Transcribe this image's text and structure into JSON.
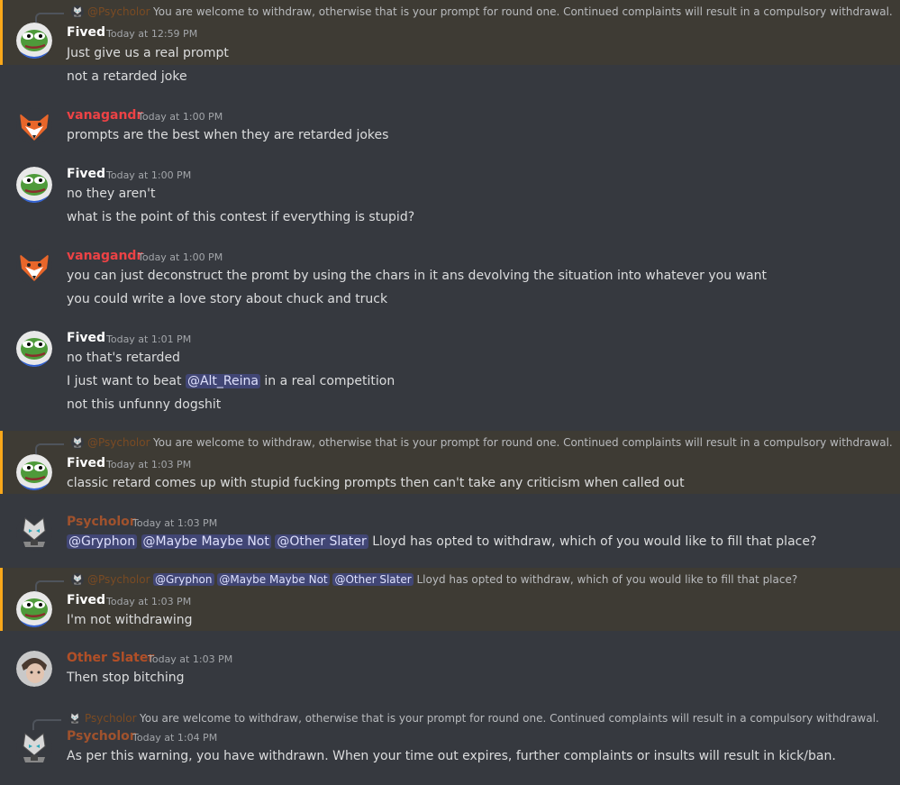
{
  "colors": {
    "fived": "#ffffff",
    "vanagandr": "#ed4245",
    "psycholor": "#a0522d",
    "other_slater": "#b14f27",
    "mention_bg": "#3e3b34",
    "mention_bar": "#faa81a",
    "ping_bg": "#414675"
  },
  "reply_warning": "You are welcome to withdraw, otherwise that is your prompt for round one. Continued complaints will result in a compulsory withdrawal.",
  "reply_psy_name": "@Psycholor",
  "reply_psy_name_plain": "Psycholor",
  "m1": {
    "name": "Fived",
    "ts": "Today at 12:59 PM",
    "lines": [
      "Just give us a real prompt",
      "not a retarded joke"
    ]
  },
  "m2": {
    "name": "vanagandr",
    "ts": "Today at 1:00 PM",
    "lines": [
      "prompts are the best when they are retarded jokes"
    ]
  },
  "m3": {
    "name": "Fived",
    "ts": "Today at 1:00 PM",
    "lines": [
      "no they aren't",
      "what is the point of this contest if everything is stupid?"
    ]
  },
  "m4": {
    "name": "vanagandr",
    "ts": "Today at 1:00 PM",
    "lines": [
      "you can just deconstruct the promt by using the chars in it ans devolving the situation into whatever you want",
      "you could write a love story about chuck and truck"
    ]
  },
  "m5": {
    "name": "Fived",
    "ts": "Today at 1:01 PM",
    "line1": "no that's retarded",
    "line2_pre": "I just want to beat ",
    "line2_ping": "@Alt_Reina",
    "line2_post": " in a real competition",
    "line3": "not this unfunny dogshit"
  },
  "m6": {
    "name": "Fived",
    "ts": "Today at 1:03 PM",
    "lines": [
      "classic retard comes up with stupid fucking prompts then can't take any criticism when called out"
    ]
  },
  "m7": {
    "name": "Psycholor",
    "ts": "Today at 1:03 PM",
    "pings": [
      "@Gryphon",
      "@Maybe Maybe Not",
      "@Other Slater"
    ],
    "text": " Lloyd has opted to withdraw, which of you would like to fill that place?"
  },
  "m8": {
    "name": "Fived",
    "ts": "Today at 1:03 PM",
    "lines": [
      "I'm not withdrawing"
    ]
  },
  "m9": {
    "name": "Other Slater",
    "ts": "Today at 1:03 PM",
    "lines": [
      "Then stop bitching"
    ]
  },
  "m10": {
    "name": "Psycholor",
    "ts": "Today at 1:04 PM",
    "lines": [
      "As per this warning, you have withdrawn. When your time out expires, further complaints or insults will result in kick/ban."
    ]
  }
}
